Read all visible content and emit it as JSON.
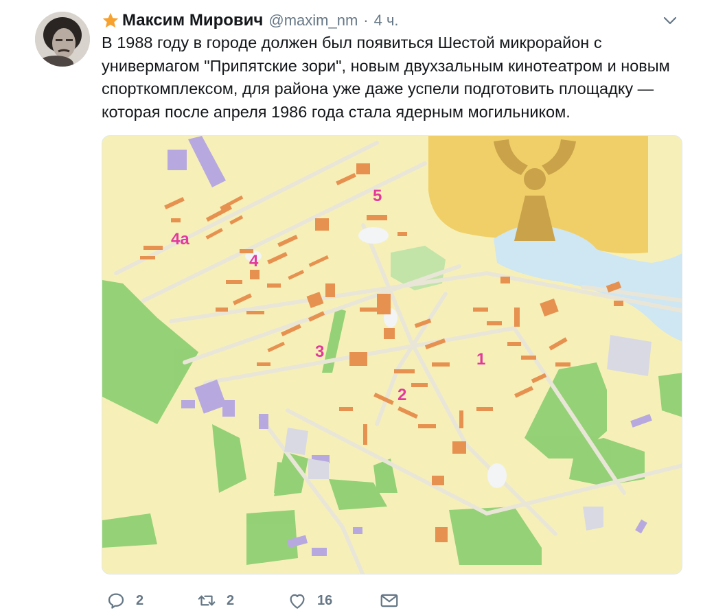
{
  "author": {
    "name": "Максим Мирович",
    "handle": "@maxim_nm",
    "separator": "·",
    "time": "4 ч."
  },
  "tweet_text": "В 1988 году в городе должен был появиться Шестой микрорайон с универмагом \"Припятские зори\", новым двухзальным кинотеатром и новым спорткомплексом, для района уже даже успели подготовить площадку — которая после апреля 1986 года стала ядерным могильником.",
  "map": {
    "district_labels": [
      "4а",
      "4",
      "5",
      "3",
      "2",
      "1"
    ],
    "colors": {
      "background": "#f6f0b8",
      "green": "#8fcf72",
      "water": "#cfe6f3",
      "nuclear": "#f0cf68",
      "trefoil": "#c9a24a",
      "building_orange": "#e6914f",
      "building_purple": "#b7a8e0",
      "label_pink": "#e2399b",
      "road": "#e9e6d8"
    }
  },
  "actions": {
    "reply_count": "2",
    "retweet_count": "2",
    "like_count": "16"
  },
  "icons": {
    "badge": "star-icon",
    "menu": "chevron-down-icon",
    "reply": "reply-icon",
    "retweet": "retweet-icon",
    "like": "heart-icon",
    "message": "envelope-icon"
  }
}
